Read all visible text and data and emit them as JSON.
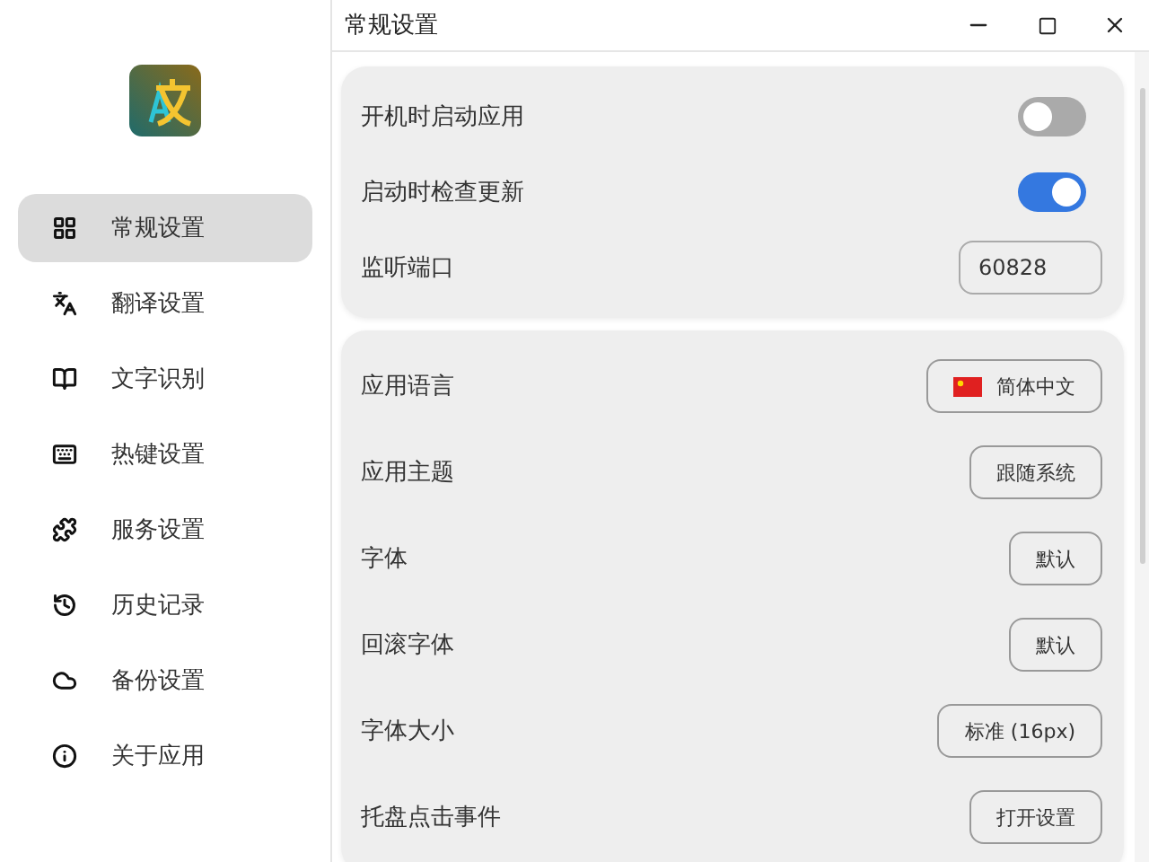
{
  "window": {
    "title": "常规设置"
  },
  "sidebar": {
    "items": [
      {
        "label": "常规设置",
        "selected": true
      },
      {
        "label": "翻译设置",
        "selected": false
      },
      {
        "label": "文字识别",
        "selected": false
      },
      {
        "label": "热键设置",
        "selected": false
      },
      {
        "label": "服务设置",
        "selected": false
      },
      {
        "label": "历史记录",
        "selected": false
      },
      {
        "label": "备份设置",
        "selected": false
      },
      {
        "label": "关于应用",
        "selected": false
      }
    ]
  },
  "cards": [
    {
      "rows": [
        {
          "label": "开机时启动应用",
          "kind": "toggle",
          "on": false
        },
        {
          "label": "启动时检查更新",
          "kind": "toggle",
          "on": true
        },
        {
          "label": "监听端口",
          "kind": "input",
          "value": "60828"
        }
      ]
    },
    {
      "rows": [
        {
          "label": "应用语言",
          "kind": "button",
          "value": "简体中文",
          "flag": true
        },
        {
          "label": "应用主题",
          "kind": "button",
          "value": "跟随系统"
        },
        {
          "label": "字体",
          "kind": "button",
          "value": "默认"
        },
        {
          "label": "回滚字体",
          "kind": "button",
          "value": "默认"
        },
        {
          "label": "字体大小",
          "kind": "button",
          "value": "标准 (16px)"
        },
        {
          "label": "托盘点击事件",
          "kind": "button",
          "value": "打开设置"
        }
      ]
    }
  ]
}
